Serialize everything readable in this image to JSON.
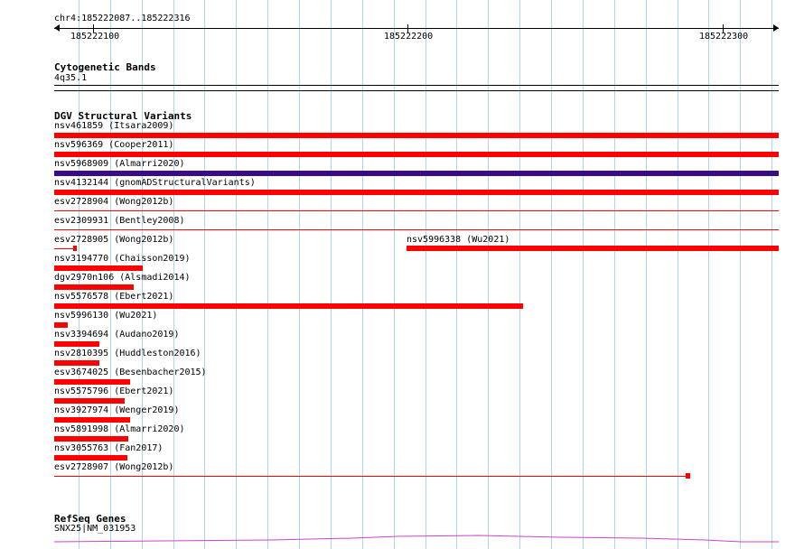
{
  "ruler": {
    "location": "chr4:185222087..185222316",
    "ticks": [
      "185222100",
      "185222200",
      "185222300"
    ]
  },
  "cytoband": {
    "title": "Cytogenetic Bands",
    "band": "4q35.1"
  },
  "dgv": {
    "title": "DGV Structural Variants",
    "colors": {
      "loss": "#ff0000",
      "gain": "#3a0a8c"
    },
    "variants": [
      {
        "label": "nsv461859 (Itsara2009)",
        "style": "bar",
        "color": "#ff0000"
      },
      {
        "label": "nsv596369 (Cooper2011)",
        "style": "bar",
        "color": "#ff0000"
      },
      {
        "label": "nsv5968909 (Almarri2020)",
        "style": "bar",
        "color": "#3a0a8c"
      },
      {
        "label": "nsv4132144 (gnomADStructuralVariants)",
        "style": "bar",
        "color": "#ff0000"
      },
      {
        "label": "esv2728904 (Wong2012b)",
        "style": "line",
        "color": "#ff0000"
      },
      {
        "label": "esv2309931 (Bentley2008)",
        "style": "line",
        "color": "#ff0000"
      },
      {
        "label": "esv2728905 (Wong2012b)",
        "style": "line-end",
        "color": "#ff0000"
      },
      {
        "label": "nsv5996338 (Wu2021)",
        "style": "bar",
        "color": "#ff0000"
      },
      {
        "label": "nsv3194770 (Chaisson2019)",
        "style": "bar",
        "color": "#ff0000"
      },
      {
        "label": "dgv2970n106 (Alsmadi2014)",
        "style": "bar",
        "color": "#ff0000"
      },
      {
        "label": "nsv5576578 (Ebert2021)",
        "style": "bar",
        "color": "#ff0000"
      },
      {
        "label": "nsv5996130 (Wu2021)",
        "style": "bar",
        "color": "#ff0000"
      },
      {
        "label": "nsv3394694 (Audano2019)",
        "style": "bar",
        "color": "#ff0000"
      },
      {
        "label": "nsv2810395 (Huddleston2016)",
        "style": "bar",
        "color": "#ff0000"
      },
      {
        "label": "esv3674025 (Besenbacher2015)",
        "style": "bar",
        "color": "#ff0000"
      },
      {
        "label": "nsv5575796 (Ebert2021)",
        "style": "bar",
        "color": "#ff0000"
      },
      {
        "label": "nsv3927974 (Wenger2019)",
        "style": "bar",
        "color": "#ff0000"
      },
      {
        "label": "nsv5891998 (Almarri2020)",
        "style": "bar",
        "color": "#ff0000"
      },
      {
        "label": "nsv3055763 (Fan2017)",
        "style": "bar",
        "color": "#ff0000"
      },
      {
        "label": "esv2728907 (Wong2012b)",
        "style": "line-end",
        "color": "#ff0000"
      }
    ]
  },
  "refseq": {
    "title": "RefSeq Genes",
    "gene": "SNX25|NM_031953",
    "color": "#cc44cc"
  },
  "gridColor": "#a8d8ee"
}
